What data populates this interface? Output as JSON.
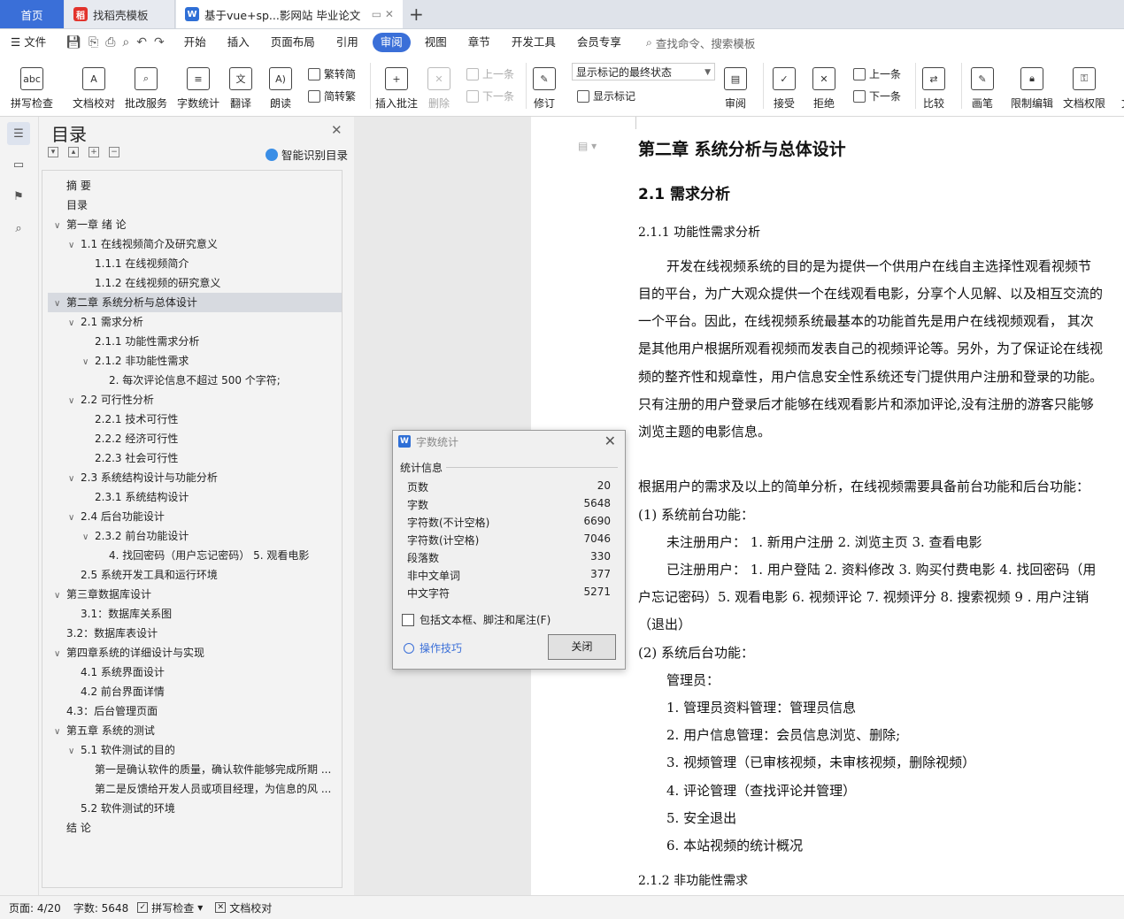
{
  "tabs": {
    "home": "首页",
    "template": "找稻壳模板",
    "document": "基于vue+sp...影网站 毕业论文"
  },
  "menu": {
    "file": "文件",
    "items": [
      "开始",
      "插入",
      "页面布局",
      "引用",
      "审阅",
      "视图",
      "章节",
      "开发工具",
      "会员专享"
    ],
    "active": "审阅",
    "search": "查找命令、搜索模板"
  },
  "ribbon": {
    "spellcheck": "拼写检查",
    "doc_check": "文档校对",
    "batch_review": "批改服务",
    "word_count": "字数统计",
    "translate": "翻译",
    "read_aloud": "朗读",
    "to_traditional": "繁转简",
    "to_simplified": "简转繁",
    "insert_comment": "插入批注",
    "delete": "删除",
    "prev": "上一条",
    "next": "下一条",
    "revise": "修订",
    "markup_mode": "显示标记的最终状态",
    "show_markup": "显示标记",
    "review": "审阅",
    "accept": "接受",
    "reject": "拒绝",
    "prev2": "上一条",
    "next2": "下一条",
    "compare": "比较",
    "pen": "画笔",
    "restrict": "限制编辑",
    "doc_rights": "文档权限",
    "overflow": "文"
  },
  "toc": {
    "title": "目录",
    "smart": "智能识别目录",
    "items": [
      {
        "text": "摘 要"
      },
      {
        "text": "目录"
      },
      {
        "text": "第一章 绪 论"
      },
      {
        "text": "1.1 在线视频简介及研究意义"
      },
      {
        "text": "1.1.1 在线视频简介"
      },
      {
        "text": "1.1.2 在线视频的研究意义"
      },
      {
        "text": "第二章 系统分析与总体设计"
      },
      {
        "text": "2.1 需求分析"
      },
      {
        "text": "2.1.1 功能性需求分析"
      },
      {
        "text": "2.1.2 非功能性需求"
      },
      {
        "text": "2. 每次评论信息不超过 500 个字符;"
      },
      {
        "text": "2.2 可行性分析"
      },
      {
        "text": "2.2.1 技术可行性"
      },
      {
        "text": "2.2.2 经济可行性"
      },
      {
        "text": "2.2.3 社会可行性"
      },
      {
        "text": "2.3 系统结构设计与功能分析"
      },
      {
        "text": "2.3.1 系统结构设计"
      },
      {
        "text": "2.4 后台功能设计"
      },
      {
        "text": "2.3.2 前台功能设计"
      },
      {
        "text": "4. 找回密码（用户忘记密码） 5. 观看电影"
      },
      {
        "text": "2.5 系统开发工具和运行环境"
      },
      {
        "text": "第三章数据库设计"
      },
      {
        "text": "3.1：数据库关系图"
      },
      {
        "text": "3.2：数据库表设计"
      },
      {
        "text": "第四章系统的详细设计与实现"
      },
      {
        "text": "4.1 系统界面设计"
      },
      {
        "text": "4.2 前台界面详情"
      },
      {
        "text": "4.3：后台管理页面"
      },
      {
        "text": "第五章 系统的测试"
      },
      {
        "text": "5.1 软件测试的目的"
      },
      {
        "text": "第一是确认软件的质量，确认软件能够完成所期 ..."
      },
      {
        "text": "第二是反馈给开发人员或项目经理，为信息的风 ..."
      },
      {
        "text": "5.2 软件测试的环境"
      },
      {
        "text": "结 论"
      }
    ]
  },
  "document": {
    "chapter": "第二章 系统分析与总体设计",
    "section": "2.1 需求分析",
    "subsection": "2.1.1 功能性需求分析",
    "para1": [
      "开发在线视频系统的目的是为提供一个供用户在线自主选择性观看视频节",
      "目的平台，为广大观众提供一个在线观看电影，分享个人见解、以及相互交流的",
      "一个平台。因此，在线视频系统最基本的功能首先是用户在线视频观看， 其次",
      "是其他用户根据所观看视频而发表自己的视频评论等。另外，为了保证论在线视",
      "频的整齐性和规章性，用户信息安全性系统还专门提供用户注册和登录的功能。",
      "只有注册的用户登录后才能够在线观看影片和添加评论,没有注册的游客只能够",
      "浏览主题的电影信息。"
    ],
    "para2": "根据用户的需求及以上的简单分析，在线视频需要具备前台功能和后台功能：",
    "front_title": "(1) 系统前台功能：",
    "unregistered": "未注册用户： 1. 新用户注册 2. 浏览主页 3. 查看电影",
    "registered": [
      "已注册用户： 1. 用户登陆 2. 资料修改 3. 购买付费电影 4. 找回密码（用",
      "户忘记密码）5. 观看电影 6. 视频评论 7. 视频评分 8. 搜索视频 9 . 用户注销",
      "（退出）"
    ],
    "back_title": "(2) 系统后台功能：",
    "admin": "管理员：",
    "admin_items": [
      "1. 管理员资料管理：管理员信息",
      "2. 用户信息管理：会员信息浏览、删除;",
      "3. 视频管理（已审核视频，未审核视频，删除视频）",
      "4. 评论管理（查找评论并管理）",
      "5. 安全退出",
      "6. 本站视频的统计概况"
    ],
    "next_heading": "2.1.2 非功能性需求"
  },
  "dialog": {
    "title": "字数统计",
    "section": "统计信息",
    "stats": [
      {
        "label": "页数",
        "value": "20"
      },
      {
        "label": "字数",
        "value": "5648"
      },
      {
        "label": "字符数(不计空格)",
        "value": "6690"
      },
      {
        "label": "字符数(计空格)",
        "value": "7046"
      },
      {
        "label": "段落数",
        "value": "330"
      },
      {
        "label": "非中文单词",
        "value": "377"
      },
      {
        "label": "中文字符",
        "value": "5271"
      }
    ],
    "include_label": "包括文本框、脚注和尾注(F)",
    "tips": "操作技巧",
    "close_button": "关闭"
  },
  "status": {
    "page": "页面: 4/20",
    "words": "字数: 5648",
    "spellcheck": "拼写检查",
    "doc_check": "文档校对"
  }
}
